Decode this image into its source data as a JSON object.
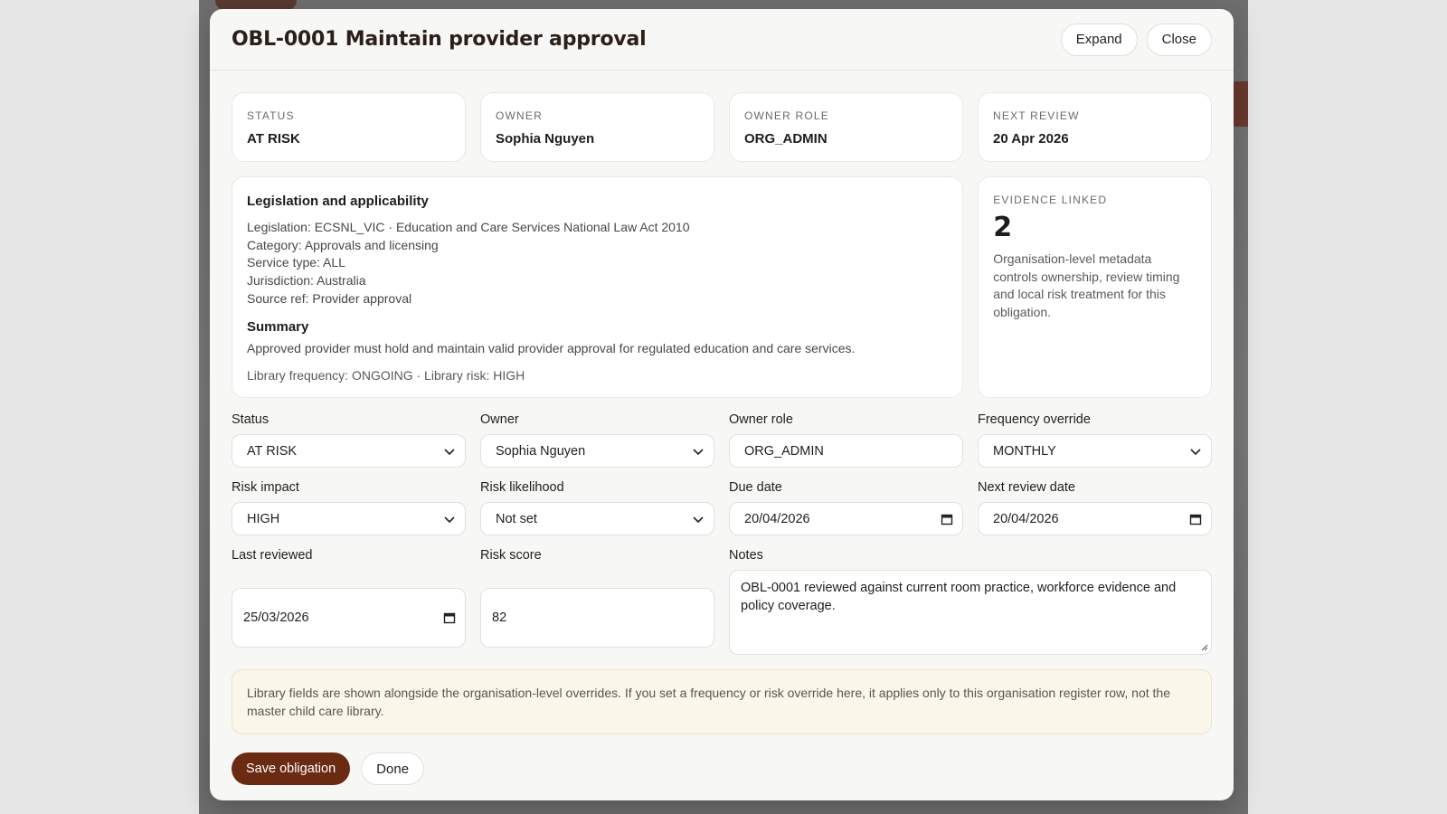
{
  "modal": {
    "title": "OBL-0001 Maintain provider approval",
    "expand_label": "Expand",
    "close_label": "Close"
  },
  "summary_cards": [
    {
      "label": "STATUS",
      "value": "AT RISK"
    },
    {
      "label": "OWNER",
      "value": "Sophia Nguyen"
    },
    {
      "label": "OWNER ROLE",
      "value": "ORG_ADMIN"
    },
    {
      "label": "NEXT REVIEW",
      "value": "20 Apr 2026"
    }
  ],
  "legislation": {
    "heading": "Legislation and applicability",
    "lines": [
      "Legislation: ECSNL_VIC · Education and Care Services National Law Act 2010",
      "Category: Approvals and licensing",
      "Service type: ALL",
      "Jurisdiction: Australia",
      "Source ref: Provider approval"
    ],
    "summary_heading": "Summary",
    "summary_text": "Approved provider must hold and maintain valid provider approval for regulated education and care services.",
    "library_line": "Library frequency: ONGOING · Library risk: HIGH"
  },
  "evidence": {
    "label": "EVIDENCE LINKED",
    "count": "2",
    "description": "Organisation-level metadata controls ownership, review timing and local risk treatment for this obligation."
  },
  "form": {
    "status": {
      "label": "Status",
      "value": "AT RISK"
    },
    "owner": {
      "label": "Owner",
      "value": "Sophia Nguyen"
    },
    "owner_role": {
      "label": "Owner role",
      "value": "ORG_ADMIN"
    },
    "frequency_override": {
      "label": "Frequency override",
      "value": "MONTHLY"
    },
    "risk_impact": {
      "label": "Risk impact",
      "value": "HIGH"
    },
    "risk_likelihood": {
      "label": "Risk likelihood",
      "value": "Not set"
    },
    "due_date": {
      "label": "Due date",
      "value": "20/04/2026"
    },
    "next_review_date": {
      "label": "Next review date",
      "value": "20/04/2026"
    },
    "last_reviewed": {
      "label": "Last reviewed",
      "value": "25/03/2026"
    },
    "risk_score": {
      "label": "Risk score",
      "value": "82"
    },
    "notes": {
      "label": "Notes",
      "value": "OBL-0001 reviewed against current room practice, workforce evidence and policy coverage."
    }
  },
  "notice": "Library fields are shown alongside the organisation-level overrides. If you set a frequency or risk override here, it applies only to this organisation register row, not the master child care library.",
  "footer": {
    "save_label": "Save obligation",
    "done_label": "Done"
  },
  "colors": {
    "primary": "#6b2a12",
    "notice_bg": "#fbf6ea",
    "title": "#2b1f1a"
  }
}
